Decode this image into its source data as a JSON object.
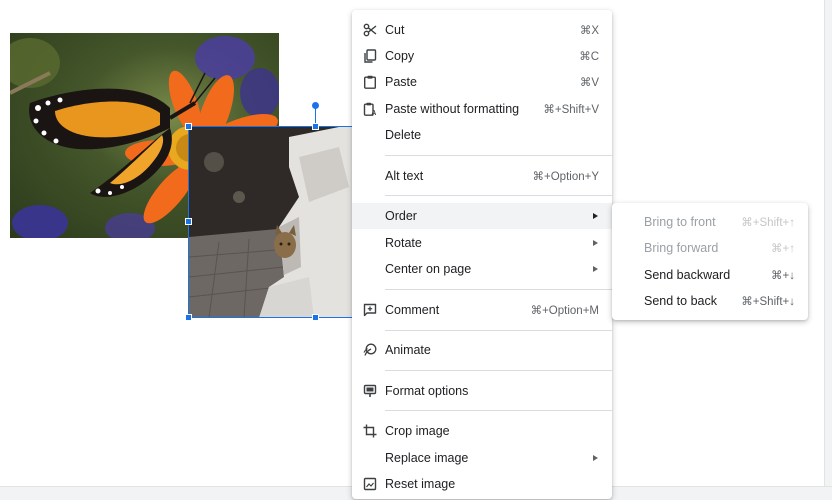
{
  "menu": {
    "items": [
      {
        "label": "Cut",
        "shortcut": "⌘X",
        "icon": "scissors-icon"
      },
      {
        "label": "Copy",
        "shortcut": "⌘C",
        "icon": "copy-icon"
      },
      {
        "label": "Paste",
        "shortcut": "⌘V",
        "icon": "clipboard-icon"
      },
      {
        "label": "Paste without formatting",
        "shortcut": "⌘+Shift+V",
        "icon": "paste-plain-icon"
      },
      {
        "label": "Delete",
        "shortcut": ""
      },
      {
        "label": "Alt text",
        "shortcut": "⌘+Option+Y"
      },
      {
        "label": "Order",
        "submenu": true
      },
      {
        "label": "Rotate",
        "submenu": true
      },
      {
        "label": "Center on page",
        "submenu": true
      },
      {
        "label": "Comment",
        "shortcut": "⌘+Option+M",
        "icon": "comment-icon"
      },
      {
        "label": "Animate",
        "icon": "animate-icon"
      },
      {
        "label": "Format options",
        "icon": "format-options-icon"
      },
      {
        "label": "Crop image",
        "icon": "crop-icon"
      },
      {
        "label": "Replace image",
        "submenu": true
      },
      {
        "label": "Reset image",
        "icon": "reset-image-icon"
      }
    ]
  },
  "submenu": {
    "items": [
      {
        "label": "Bring to front",
        "shortcut": "⌘+Shift+↑",
        "disabled": true
      },
      {
        "label": "Bring forward",
        "shortcut": "⌘+↑",
        "disabled": true
      },
      {
        "label": "Send backward",
        "shortcut": "⌘+↓",
        "disabled": false
      },
      {
        "label": "Send to back",
        "shortcut": "⌘+Shift+↓",
        "disabled": false
      }
    ]
  },
  "colors": {
    "selection": "#1a73e8",
    "menu_hover": "#f1f3f4",
    "text": "#202124",
    "disabled_text": "#9aa0a6"
  }
}
